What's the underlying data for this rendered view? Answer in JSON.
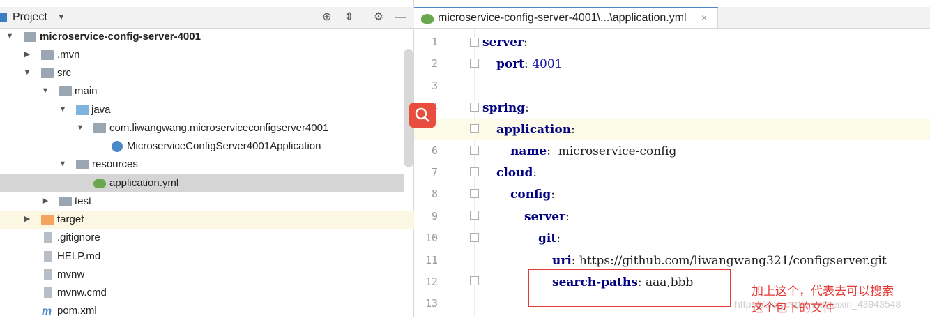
{
  "project": {
    "title": "Project",
    "tree": [
      {
        "label": "microservice-config-server-4001",
        "bold": true
      },
      {
        "label": ".mvn"
      },
      {
        "label": "src"
      },
      {
        "label": "main"
      },
      {
        "label": "java"
      },
      {
        "label": "com.liwangwang.microserviceconfigserver4001"
      },
      {
        "label": "MicroserviceConfigServer4001Application"
      },
      {
        "label": "resources"
      },
      {
        "label": "application.yml"
      },
      {
        "label": "test"
      },
      {
        "label": "target"
      },
      {
        "label": ".gitignore"
      },
      {
        "label": "HELP.md"
      },
      {
        "label": "mvnw"
      },
      {
        "label": "mvnw.cmd"
      },
      {
        "label": "pom.xml"
      }
    ]
  },
  "editor": {
    "tab_label": "microservice-config-server-4001\\...\\application.yml",
    "tab_close": "×",
    "line_numbers": [
      "1",
      "2",
      "3",
      "4",
      "5",
      "6",
      "7",
      "8",
      "9",
      "10",
      "11",
      "12",
      "13"
    ],
    "lines": [
      {
        "key": "server",
        "sep": ":",
        "value": ""
      },
      {
        "key": "port",
        "sep": ": ",
        "value": "4001"
      },
      {
        "key": "",
        "sep": "",
        "value": ""
      },
      {
        "key": "spring",
        "sep": ":",
        "value": ""
      },
      {
        "key": "application",
        "sep": ":",
        "value": ""
      },
      {
        "key": "name",
        "sep": ":  ",
        "value": "microservice-config"
      },
      {
        "key": "cloud",
        "sep": ":",
        "value": ""
      },
      {
        "key": "config",
        "sep": ":",
        "value": ""
      },
      {
        "key": "server",
        "sep": ":",
        "value": ""
      },
      {
        "key": "git",
        "sep": ":",
        "value": ""
      },
      {
        "key": "uri",
        "sep": ": ",
        "value": "https://github.com/liwangwang321/configserver.git"
      },
      {
        "key": "search-paths",
        "sep": ": ",
        "value": "aaa,bbb"
      },
      {
        "key": "",
        "sep": "",
        "value": ""
      }
    ]
  },
  "annotation": {
    "line1": "加上这个，代表去可以搜索",
    "line2": "这个包下的文件",
    "watermark": "https://blog.csdn.net/weixin_43943548"
  }
}
